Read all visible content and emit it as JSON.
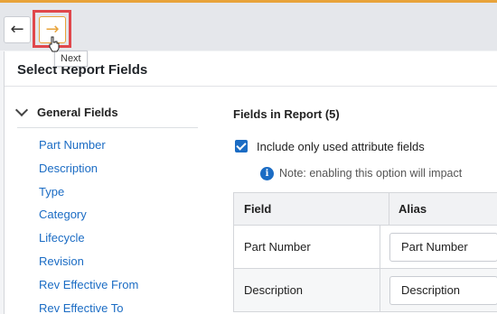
{
  "toolbar": {
    "back_icon": "←",
    "next_icon": "→",
    "tooltip": "Next",
    "accent": "#e8a33a",
    "highlight_color": "#e0474c"
  },
  "panel": {
    "title": "Select Report Fields"
  },
  "general_fields": {
    "label": "General Fields",
    "items": [
      "Part Number",
      "Description",
      "Type",
      "Category",
      "Lifecycle",
      "Revision",
      "Rev Effective From",
      "Rev Effective To"
    ]
  },
  "fields_in_report": {
    "title": "Fields in Report (5)",
    "checkbox_label": "Include only used attribute fields",
    "checkbox_checked": true,
    "note": "Note: enabling this option will impact",
    "info_icon": "i",
    "columns": [
      "Field",
      "Alias"
    ],
    "rows": [
      {
        "field": "Part Number",
        "alias": "Part Number"
      },
      {
        "field": "Description",
        "alias": "Description"
      }
    ]
  }
}
